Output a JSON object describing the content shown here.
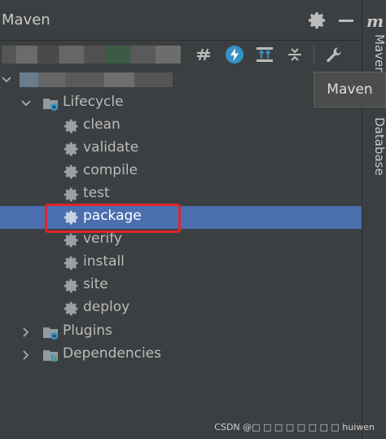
{
  "title_bar": {
    "title": "Maven"
  },
  "side_strip": {
    "logo": "m",
    "maven_tab": "Maven",
    "database_tab": "Database"
  },
  "tooltip": {
    "text": "Maven"
  },
  "tree": {
    "lifecycle_label": "Lifecycle",
    "phases": [
      "clean",
      "validate",
      "compile",
      "test",
      "package",
      "verify",
      "install",
      "site",
      "deploy"
    ],
    "selected_phase": "package",
    "plugins_label": "Plugins",
    "dependencies_label": "Dependencies"
  },
  "watermark": "CSDN @□ □ □ □ □ □ □ □ huiwen",
  "colors": {
    "panel_bg": "#3c3f41",
    "selection": "#4b6eaf",
    "highlight": "#e0242a",
    "accent_icon": "#3592c4"
  }
}
